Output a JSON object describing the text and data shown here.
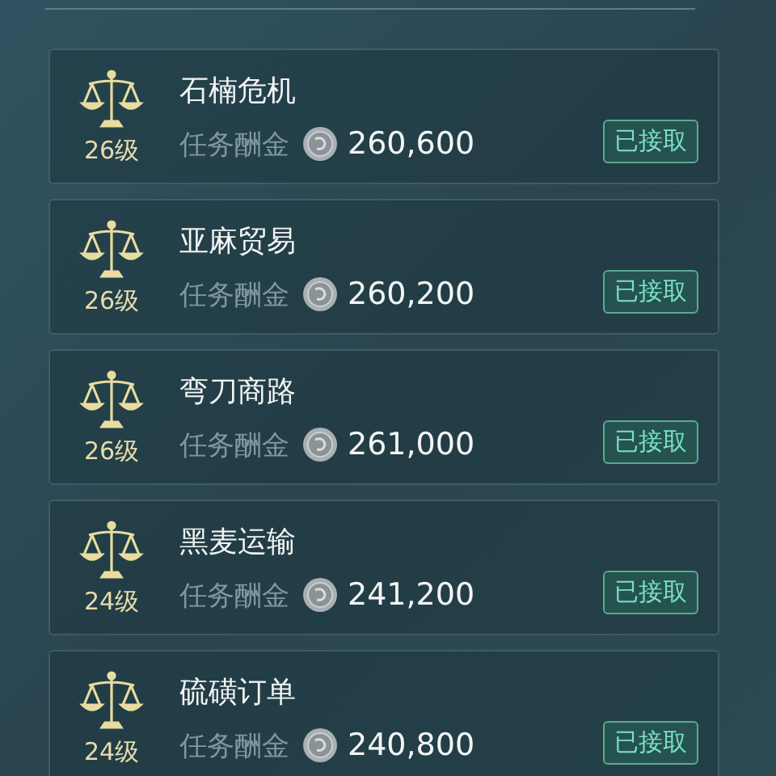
{
  "quests": [
    {
      "level": "26级",
      "name": "石楠危机",
      "reward_label": "任务酬金",
      "reward": "260,600",
      "status": "已接取"
    },
    {
      "level": "26级",
      "name": "亚麻贸易",
      "reward_label": "任务酬金",
      "reward": "260,200",
      "status": "已接取"
    },
    {
      "level": "26级",
      "name": "弯刀商路",
      "reward_label": "任务酬金",
      "reward": "261,000",
      "status": "已接取"
    },
    {
      "level": "24级",
      "name": "黑麦运输",
      "reward_label": "任务酬金",
      "reward": "241,200",
      "status": "已接取"
    },
    {
      "level": "24级",
      "name": "硫磺订单",
      "reward_label": "任务酬金",
      "reward": "240,800",
      "status": "已接取"
    }
  ]
}
